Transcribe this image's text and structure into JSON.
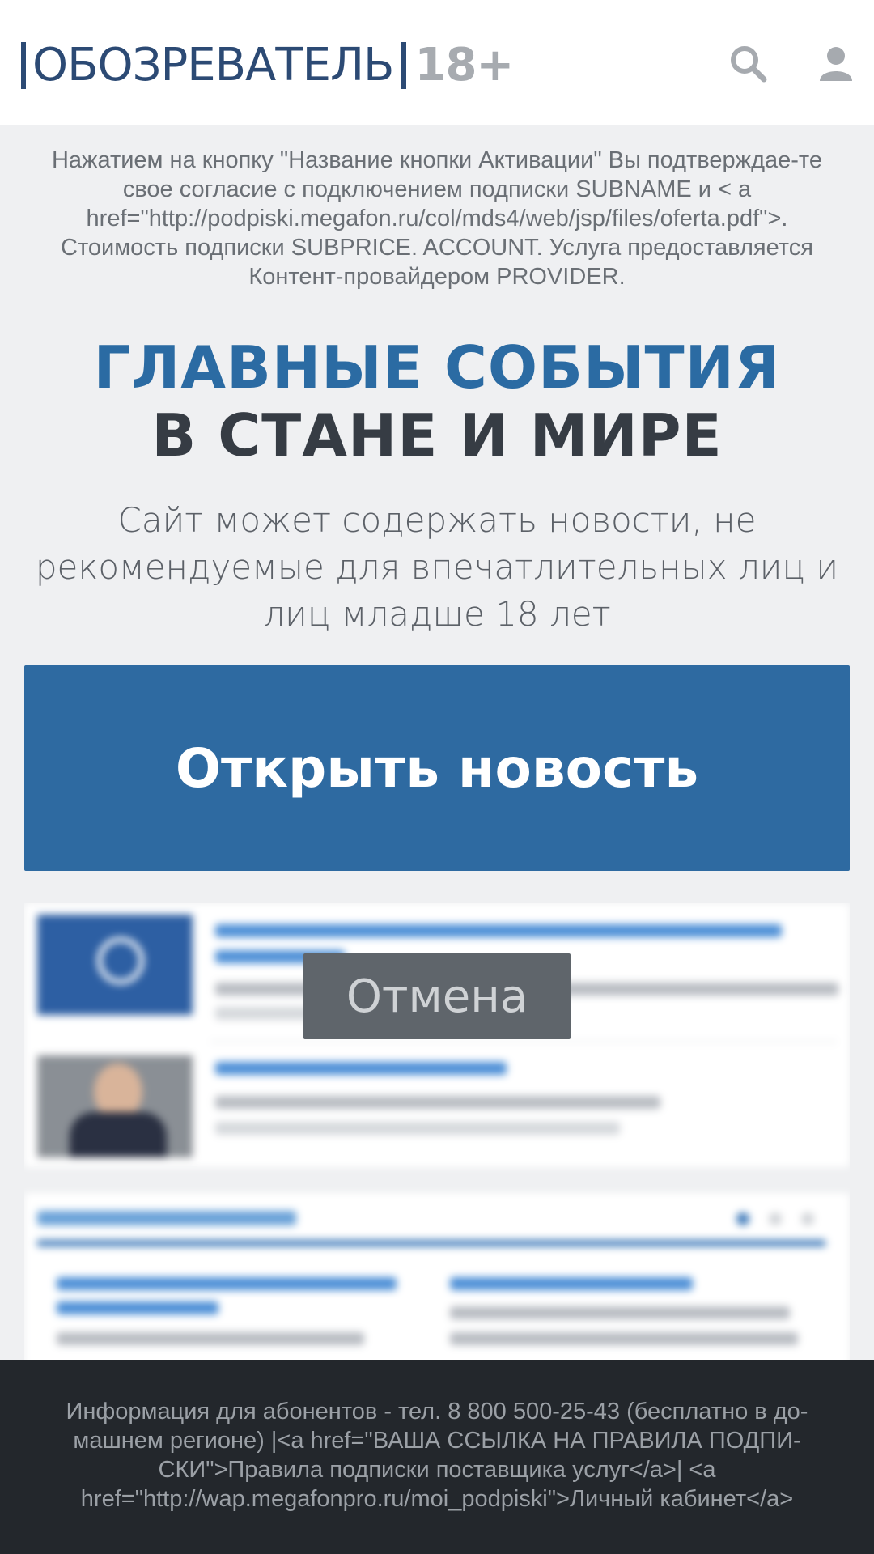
{
  "header": {
    "logo_name": "ОБОЗРЕВАТЕЛЬ",
    "logo_age": "18+",
    "icons": [
      "search-icon",
      "user-icon"
    ]
  },
  "disclaimer": "Нажатием на кнопку \"Название кнопки Активации\" Вы подтверждае-те свое согласие с подключением подписки SUBNAME и < a href=\"http://podpiski.megafon.ru/col/mds4/web/jsp/files/oferta.pdf\">. Стоимость подписки SUBPRICE. ACCOUNT. Услуга предоставляется Контент-провайдером PROVIDER.",
  "headline": {
    "line1": "ГЛАВНЫЕ СОБЫТИЯ",
    "line2": "В СТАНЕ И МИРЕ"
  },
  "subtitle": "Сайт может содержать новости, не рекомендуемые для впечатлительных лиц и лиц младше 18 лет",
  "buttons": {
    "open": "Открыть новость",
    "cancel": "Отмена"
  },
  "footer": "Информация для абонентов - тел. 8 800 500-25-43 (бесплатно в до-машнем регионе) |<a href=\"ВАША ССЫЛКА НА ПРАВИЛА ПОДПИ-СКИ\">Правила подписки поставщика услуг</a>| <a href=\"http://wap.megafonpro.ru/moi_podpiski\">Личный кабинет</a>",
  "colors": {
    "brand_blue": "#2e6aa1",
    "logo": "#2c4a74",
    "heading_dark": "#363c44",
    "cancel": "#5f656b",
    "footer_bg": "#23272c"
  }
}
